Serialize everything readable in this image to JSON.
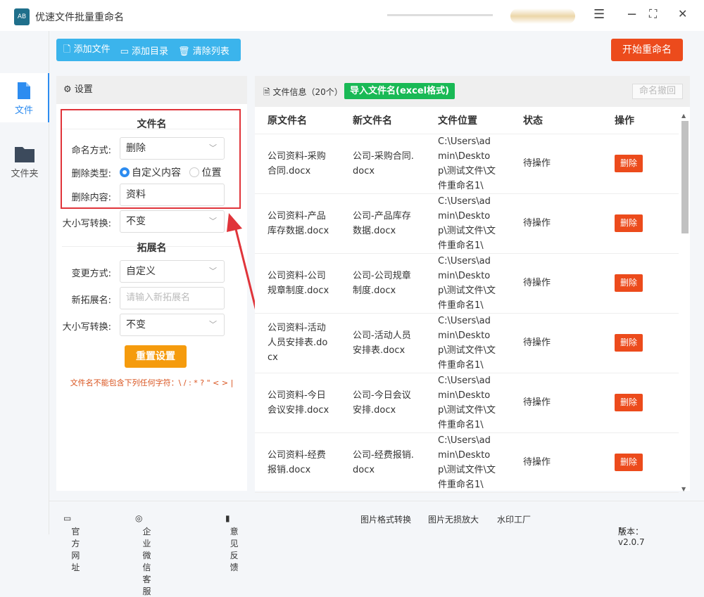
{
  "app": {
    "title": "优速文件批量重命名",
    "logo": "AB"
  },
  "window": {
    "menu": "☰",
    "minimize": "−",
    "maximize": "⛶",
    "close": "✕"
  },
  "sidebar": {
    "items": [
      {
        "label": "文件",
        "icon": "file-icon"
      },
      {
        "label": "文件夹",
        "icon": "folder-icon"
      }
    ]
  },
  "toolbar": {
    "add_file": "添加文件",
    "add_dir": "添加目录",
    "clear": "清除列表",
    "start": "开始重命名"
  },
  "settings": {
    "title": "设置",
    "filename_section": "文件名",
    "naming_label": "命名方式:",
    "naming_value": "删除",
    "delete_type_label": "删除类型:",
    "delete_type_options": [
      "自定义内容",
      "位置"
    ],
    "delete_type_selected": "自定义内容",
    "delete_content_label": "删除内容:",
    "delete_content_value": "资料",
    "case_label": "大小写转换:",
    "case_value": "不变",
    "ext_section": "拓展名",
    "change_label": "变更方式:",
    "change_value": "自定义",
    "new_ext_label": "新拓展名:",
    "new_ext_placeholder": "请输入新拓展名",
    "ext_case_label": "大小写转换:",
    "ext_case_value": "不变",
    "reset": "重置设置",
    "warning": "文件名不能包含下列任何字符：\\ / : * ? \" < > |"
  },
  "files": {
    "title": "文件信息（20个）",
    "import": "导入文件名(excel格式)",
    "undo": "命名撤回",
    "columns": [
      "原文件名",
      "新文件名",
      "文件位置",
      "状态",
      "操作"
    ],
    "rows": [
      {
        "orig": "公司资料-采购合同.docx",
        "new": "公司-采购合同.docx",
        "loc": "C:\\Users\\admin\\Desktop\\测试文件\\文件重命名1\\",
        "status": "待操作",
        "action": "删除"
      },
      {
        "orig": "公司资料-产品库存数据.docx",
        "new": "公司-产品库存数据.docx",
        "loc": "C:\\Users\\admin\\Desktop\\测试文件\\文件重命名1\\",
        "status": "待操作",
        "action": "删除"
      },
      {
        "orig": "公司资料-公司规章制度.docx",
        "new": "公司-公司规章制度.docx",
        "loc": "C:\\Users\\admin\\Desktop\\测试文件\\文件重命名1\\",
        "status": "待操作",
        "action": "删除"
      },
      {
        "orig": "公司资料-活动人员安排表.docx",
        "new": "公司-活动人员安排表.docx",
        "loc": "C:\\Users\\admin\\Desktop\\测试文件\\文件重命名1\\",
        "status": "待操作",
        "action": "删除"
      },
      {
        "orig": "公司资料-今日会议安排.docx",
        "new": "公司-今日会议安排.docx",
        "loc": "C:\\Users\\admin\\Desktop\\测试文件\\文件重命名1\\",
        "status": "待操作",
        "action": "删除"
      },
      {
        "orig": "公司资料-经费报销.docx",
        "new": "公司-经费报销.docx",
        "loc": "C:\\Users\\admin\\Desktop\\测试文件\\文件重命名1\\",
        "status": "待操作",
        "action": "删除"
      }
    ]
  },
  "footer": {
    "website": "官方网址",
    "wechat": "企业微信客服",
    "feedback": "意见反馈",
    "img_convert": "图片格式转换",
    "img_enlarge": "图片无损放大",
    "watermark": "水印工厂",
    "version": "版本：v2.0.7"
  },
  "colors": {
    "accent": "#2d8cf0",
    "toolbar": "#3bb4ec",
    "start": "#ec4b1c",
    "import": "#19b955",
    "reset": "#f59b0d",
    "highlight": "#e0343a"
  }
}
